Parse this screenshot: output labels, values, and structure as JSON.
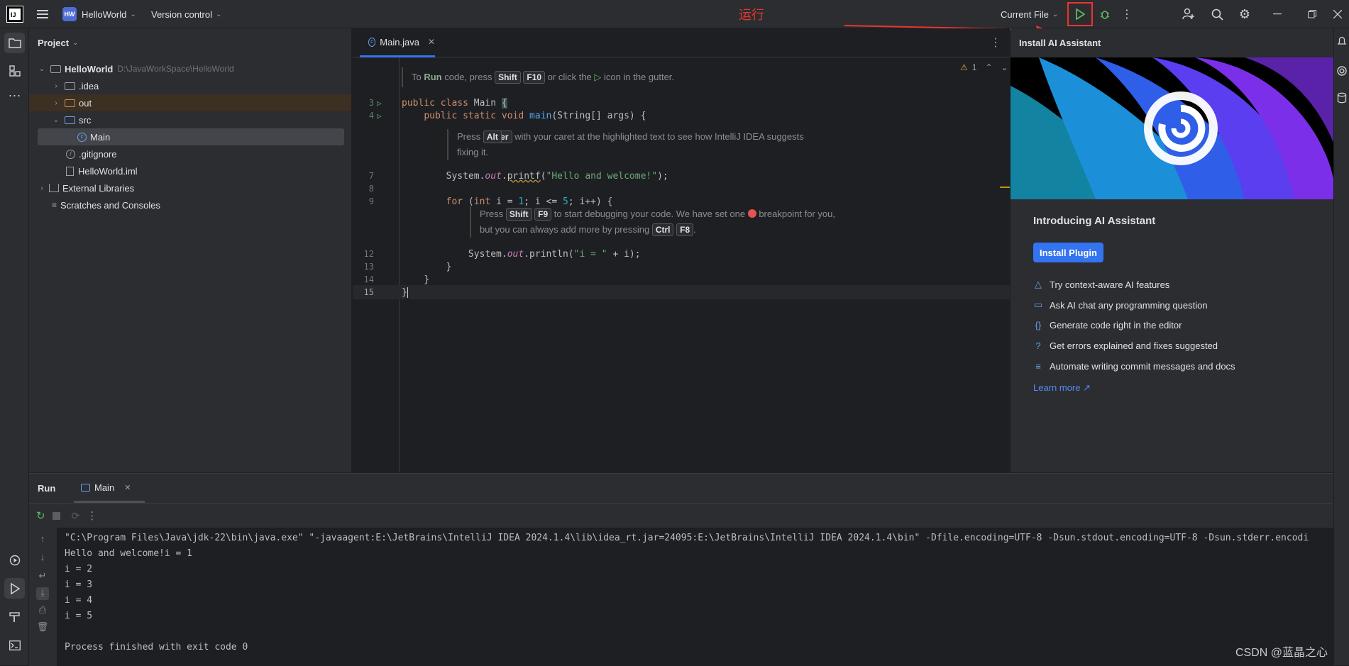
{
  "titlebar": {
    "project_badge": "HW",
    "project_name": "HelloWorld",
    "vcs": "Version control",
    "run_config": "Current File",
    "annotation": "运行",
    "colors": {
      "annotation": "#e8362f",
      "run_green": "#5fb865"
    }
  },
  "project_panel": {
    "title": "Project",
    "tree": [
      {
        "label": "HelloWorld",
        "path": "D:\\JavaWorkSpace\\HelloWorld"
      },
      {
        "label": ".idea"
      },
      {
        "label": "out"
      },
      {
        "label": "src"
      },
      {
        "label": "Main"
      },
      {
        "label": ".gitignore"
      },
      {
        "label": "HelloWorld.iml"
      },
      {
        "label": "External Libraries"
      },
      {
        "label": "Scratches and Consoles"
      }
    ]
  },
  "editor": {
    "tab": "Main.java",
    "warning_count": "1",
    "hint_run": {
      "pre": "To ",
      "bold": "Run",
      "mid": " code, press ",
      "k1": "Shift",
      "k2": "F10",
      "post": " or click the ",
      "post2": " icon in the gutter."
    },
    "hint_alt": {
      "pre": "Press ",
      "k1": "Alt",
      "k2": "Enter",
      "l1": " with your caret at the highlighted text to see how IntelliJ IDEA suggests",
      "l2": "fixing it."
    },
    "hint_debug": {
      "pre": "Press ",
      "k1": "Shift",
      "k2": "F9",
      "l1": " to start debugging your code. We have set one ",
      "l1b": " breakpoint for you,",
      "l2": "but you can always add more by pressing ",
      "k3": "Ctrl",
      "k4": "F8",
      "l2end": "."
    },
    "line_numbers": [
      "3",
      "4",
      "7",
      "8",
      "9",
      "12",
      "13",
      "14",
      "15"
    ],
    "code": {
      "l3_kw1": "public",
      "l3_kw2": "class",
      "l3_name": "Main",
      "l3_brace": "{",
      "l4_kw1": "public",
      "l4_kw2": "static",
      "l4_kw3": "void",
      "l4_fn": "main",
      "l4_rest": "(String[] args) {",
      "l7_pre": "System.",
      "l7_out": "out",
      "l7_dot": ".",
      "l7_fn": "printf",
      "l7_paren": "(",
      "l7_str": "\"Hello and welcome!\"",
      "l7_end": ");",
      "l9_for": "for",
      "l9_p1": " (",
      "l9_int": "int",
      "l9_p2": " i = ",
      "l9_n1": "1",
      "l9_p3": "; i <= ",
      "l9_n2": "5",
      "l9_p4": "; i++) {",
      "l12_pre": "System.",
      "l12_out": "out",
      "l12_rest": ".println(",
      "l12_str": "\"i = \"",
      "l12_end": " + i);",
      "l13": "}",
      "l14": "}",
      "l15": "}"
    }
  },
  "ai_panel": {
    "title": "Install AI Assistant",
    "heading": "Introducing AI Assistant",
    "button": "Install Plugin",
    "features": [
      "Try context-aware AI features",
      "Ask AI chat any programming question",
      "Generate code right in the editor",
      "Get errors explained and fixes suggested",
      "Automate writing commit messages and docs"
    ],
    "learn_more": "Learn more ↗"
  },
  "run_panel": {
    "title": "Run",
    "tab": "Main",
    "console": [
      "\"C:\\Program Files\\Java\\jdk-22\\bin\\java.exe\" \"-javaagent:E:\\JetBrains\\IntelliJ IDEA 2024.1.4\\lib\\idea_rt.jar=24095:E:\\JetBrains\\IntelliJ IDEA 2024.1.4\\bin\" -Dfile.encoding=UTF-8 -Dsun.stdout.encoding=UTF-8 -Dsun.stderr.encodi",
      "Hello and welcome!i = 1",
      "i = 2",
      "i = 3",
      "i = 4",
      "i = 5",
      "",
      "Process finished with exit code 0"
    ]
  },
  "watermark": "CSDN @蓝晶之心"
}
